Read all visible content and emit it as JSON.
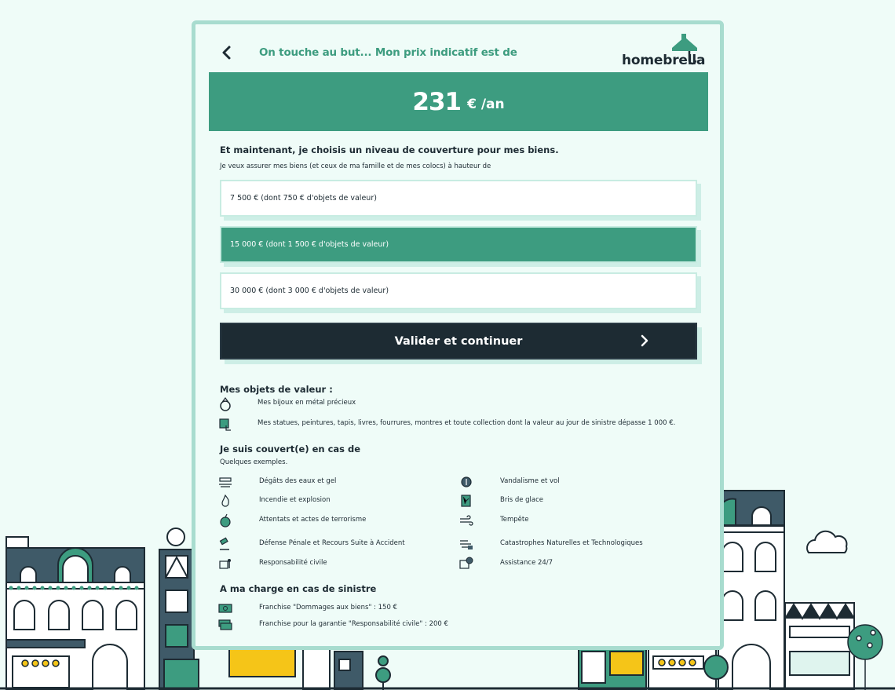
{
  "header": {
    "title": "On touche au but... Mon prix indicatif est de",
    "logo_text": "homebrella"
  },
  "price": {
    "value": "231",
    "unit": "€ /an"
  },
  "coverage": {
    "title": "Et maintenant, je choisis un niveau de couverture pour mes biens.",
    "subtitle": "Je veux assurer mes biens (et ceux de ma famille et de mes colocs) à hauteur de",
    "options": [
      {
        "label": "7 500 € (dont 750 € d'objets de valeur)",
        "selected": false
      },
      {
        "label": "15 000 € (dont 1 500 € d'objets de valeur)",
        "selected": true
      },
      {
        "label": "30 000 € (dont 3 000 € d'objets de valeur)",
        "selected": false
      }
    ],
    "cta_label": "Valider et continuer"
  },
  "valuables": {
    "title": "Mes objets de valeur :",
    "items": [
      {
        "icon": "ring-icon",
        "label": "Mes bijoux en métal précieux"
      },
      {
        "icon": "painting-icon",
        "label": "Mes statues, peintures, tapis, livres, fourrures, montres et toute collection dont la valeur au jour de sinistre dépasse 1 000 €."
      }
    ]
  },
  "covered": {
    "title": "Je suis couvert(e) en cas de",
    "subtitle": "Quelques exemples.",
    "left": [
      {
        "icon": "water-damage-icon",
        "label": "Dégâts des eaux et gel"
      },
      {
        "icon": "fire-icon",
        "label": "Incendie et explosion"
      },
      {
        "icon": "bomb-icon",
        "label": "Attentats et actes de terrorisme"
      },
      {
        "icon": "gavel-icon",
        "label": "Défense Pénale et Recours Suite à Accident"
      },
      {
        "icon": "civil-liability-icon",
        "label": "Responsabilité civile"
      }
    ],
    "right": [
      {
        "icon": "theft-icon",
        "label": "Vandalisme et vol"
      },
      {
        "icon": "broken-glass-icon",
        "label": "Bris de glace"
      },
      {
        "icon": "wind-icon",
        "label": "Tempête"
      },
      {
        "icon": "disaster-icon",
        "label": "Catastrophes Naturelles et Technologiques"
      },
      {
        "icon": "assistance-icon",
        "label": "Assistance 24/7"
      }
    ]
  },
  "charges": {
    "title": "A ma charge en cas de sinistre",
    "items": [
      {
        "icon": "money-icon",
        "label": "Franchise \"Dommages aux biens\" : 150 €"
      },
      {
        "icon": "money-stack-icon",
        "label": "Franchise pour la garantie \"Responsabilité civile\" : 200 €"
      }
    ]
  },
  "colors": {
    "brand_green": "#3d9c80",
    "dark": "#1d2b33",
    "background": "#effcf8",
    "card_border": "#a8dccf",
    "accent_yellow": "#f5c518"
  }
}
